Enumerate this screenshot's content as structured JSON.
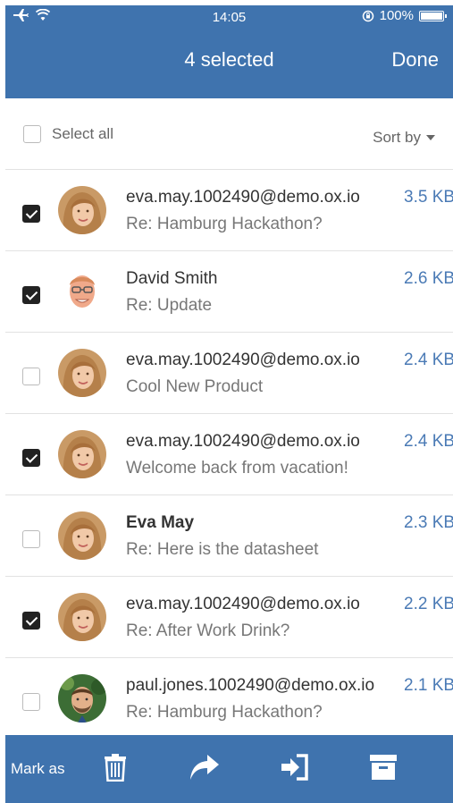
{
  "status": {
    "time": "14:05",
    "battery": "100%"
  },
  "nav": {
    "title": "4 selected",
    "done": "Done"
  },
  "selectbar": {
    "select_all": "Select all",
    "sort_by": "Sort by"
  },
  "mails": [
    {
      "from": "eva.may.1002490@demo.ox.io",
      "subject": "Re: Hamburg Hackathon?",
      "size": "3.5 KB",
      "checked": true,
      "bold": false,
      "avatar": "eva"
    },
    {
      "from": "David Smith",
      "subject": "Re: Update",
      "size": "2.6 KB",
      "checked": true,
      "bold": false,
      "avatar": "david"
    },
    {
      "from": "eva.may.1002490@demo.ox.io",
      "subject": "Cool New Product",
      "size": "2.4 KB",
      "checked": false,
      "bold": false,
      "avatar": "eva"
    },
    {
      "from": "eva.may.1002490@demo.ox.io",
      "subject": "Welcome back from vacation!",
      "size": "2.4 KB",
      "checked": true,
      "bold": false,
      "avatar": "eva"
    },
    {
      "from": "Eva May",
      "subject": "Re: Here is the datasheet",
      "size": "2.3 KB",
      "checked": false,
      "bold": true,
      "avatar": "eva"
    },
    {
      "from": "eva.may.1002490@demo.ox.io",
      "subject": "Re: After Work Drink?",
      "size": "2.2 KB",
      "checked": true,
      "bold": false,
      "avatar": "eva"
    },
    {
      "from": "paul.jones.1002490@demo.ox.io",
      "subject": "Re: Hamburg Hackathon?",
      "size": "2.1 KB",
      "checked": false,
      "bold": false,
      "avatar": "paul"
    }
  ],
  "toolbar": {
    "mark_as": "Mark as",
    "icons": [
      "trash-icon",
      "forward-icon",
      "move-icon",
      "archive-icon"
    ]
  },
  "colors": {
    "brand": "#3f73ae",
    "size_text": "#4a7ab5"
  }
}
